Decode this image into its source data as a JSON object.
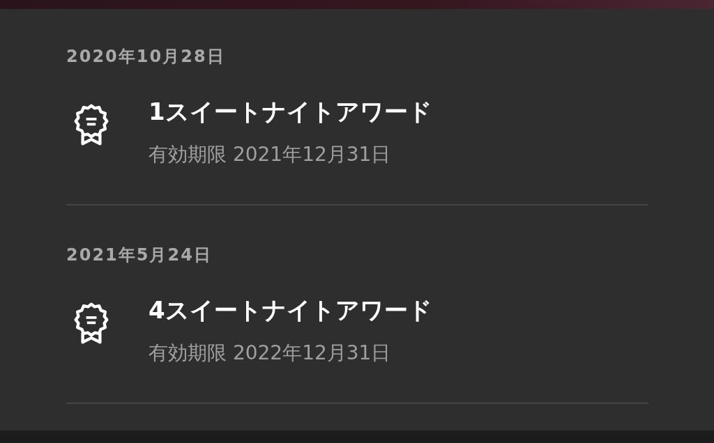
{
  "awards": [
    {
      "date": "2020年10月28日",
      "title": "1スイートナイトアワード",
      "expiry": "有効期限 2021年12月31日"
    },
    {
      "date": "2021年5月24日",
      "title": "4スイートナイトアワード",
      "expiry": "有効期限 2022年12月31日"
    }
  ]
}
